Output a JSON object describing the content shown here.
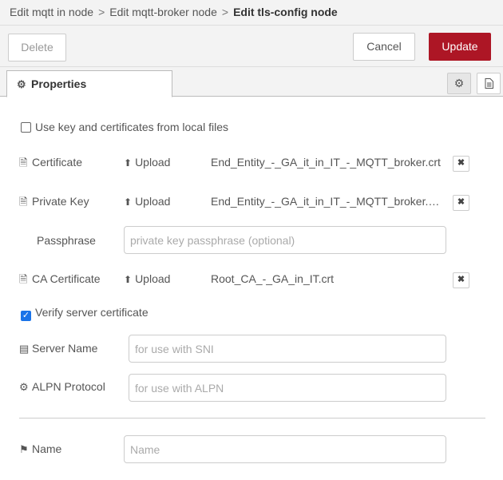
{
  "breadcrumb": {
    "items": [
      "Edit mqtt in node",
      "Edit mqtt-broker node"
    ],
    "current": "Edit tls-config node",
    "separator": ">"
  },
  "toolbar": {
    "delete_label": "Delete",
    "cancel_label": "Cancel",
    "update_label": "Update"
  },
  "tabs": {
    "properties_label": "Properties"
  },
  "form": {
    "use_local_files": {
      "label": "Use key and certificates from local files",
      "checked": false
    },
    "certificate": {
      "label": "Certificate",
      "upload_label": "Upload",
      "filename": "End_Entity_-_GA_it_in_IT_-_MQTT_broker.crt"
    },
    "private_key": {
      "label": "Private Key",
      "upload_label": "Upload",
      "filename": "End_Entity_-_GA_it_in_IT_-_MQTT_broker.key"
    },
    "passphrase": {
      "label": "Passphrase",
      "placeholder": "private key passphrase (optional)"
    },
    "ca_certificate": {
      "label": "CA Certificate",
      "upload_label": "Upload",
      "filename": "Root_CA_-_GA_in_IT.crt"
    },
    "verify_server": {
      "label": "Verify server certificate",
      "checked": true
    },
    "server_name": {
      "label": "Server Name",
      "placeholder": "for use with SNI"
    },
    "alpn": {
      "label": "ALPN Protocol",
      "placeholder": "for use with ALPN"
    },
    "name": {
      "label": "Name",
      "placeholder": "Name"
    }
  },
  "colors": {
    "accent": "#ad1625",
    "checkbox": "#1a73e8"
  }
}
